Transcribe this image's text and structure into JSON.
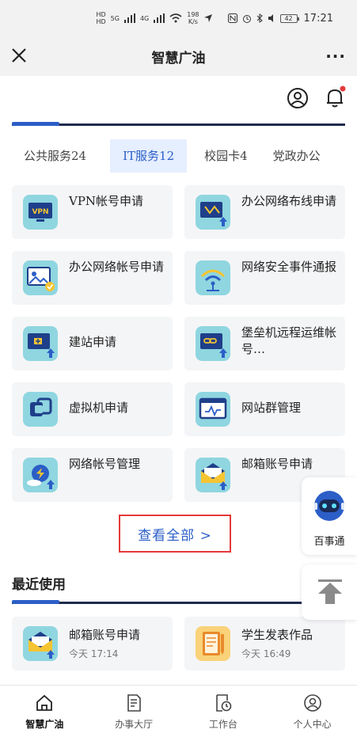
{
  "status_bar": {
    "hd1": "HD",
    "hd2": "HD",
    "net1": "5G",
    "net2": "4G",
    "speed": "198",
    "speed_unit": "K/s",
    "battery": "42",
    "time": "17:21"
  },
  "title_bar": {
    "title": "智慧广油",
    "more": "···"
  },
  "tabs": [
    {
      "label": "公共服务24"
    },
    {
      "label": "IT服务12"
    },
    {
      "label": "校园卡4"
    },
    {
      "label": "党政办公"
    }
  ],
  "services": [
    {
      "label": "VPN帐号申请",
      "icon": "vpn-icon"
    },
    {
      "label": "办公网络布线申请",
      "icon": "network-wiring-icon"
    },
    {
      "label": "办公网络帐号申请",
      "icon": "network-account-icon"
    },
    {
      "label": "网络安全事件通报",
      "icon": "wifi-alert-icon"
    },
    {
      "label": "建站申请",
      "icon": "website-build-icon"
    },
    {
      "label": "堡垒机远程运维帐号…",
      "icon": "bastion-icon"
    },
    {
      "label": "虚拟机申请",
      "icon": "vm-icon"
    },
    {
      "label": "网站群管理",
      "icon": "site-group-icon"
    },
    {
      "label": "网络帐号管理",
      "icon": "net-account-manage-icon"
    },
    {
      "label": "邮箱账号申请",
      "icon": "mail-icon"
    }
  ],
  "view_all": "查看全部 >",
  "recent": {
    "title": "最近使用",
    "items": [
      {
        "name": "邮箱账号申请",
        "time": "今天 17:14",
        "icon": "mail-icon"
      },
      {
        "name": "学生发表作品",
        "time": "今天 16:49",
        "icon": "notebook-icon"
      }
    ]
  },
  "floating": {
    "assistant": "百事通"
  },
  "bottom_nav": [
    {
      "label": "智慧广油",
      "icon": "home-icon"
    },
    {
      "label": "办事大厅",
      "icon": "document-icon"
    },
    {
      "label": "工作台",
      "icon": "workbench-icon"
    },
    {
      "label": "个人中心",
      "icon": "person-icon"
    }
  ],
  "colors": {
    "accent": "#2b5ec7",
    "highlight_box": "#e53a3a",
    "icon_bg": "#8fd6e0",
    "notification_dot": "#e53a3a"
  }
}
